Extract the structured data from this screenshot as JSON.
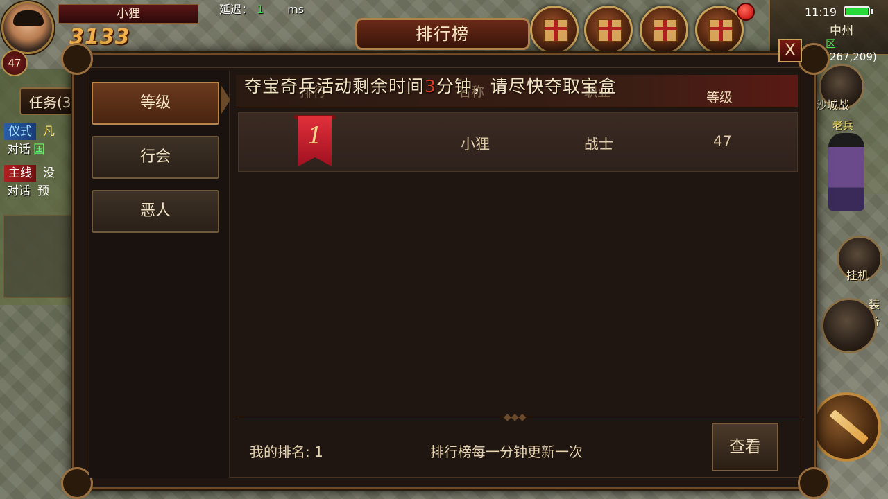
{
  "hud": {
    "player_name": "小狸",
    "player_level": "47",
    "combat_power": "3133",
    "latency_label": "延迟：",
    "latency_value": "1",
    "latency_unit": "ms",
    "quest_tab": "任务(3",
    "quests": [
      {
        "tag": "仪式",
        "tag_color": "blue",
        "text": "凡"
      },
      {
        "tag": "对话",
        "text": "国"
      },
      {
        "tag": "主线",
        "tag_color": "red",
        "text": "没"
      },
      {
        "tag": "对话",
        "text": "预"
      }
    ]
  },
  "status": {
    "time": "11:19",
    "zone": "中州",
    "zone_marker": "区",
    "coordinates": "(267,209)"
  },
  "side": {
    "sabak_label": "沙城战",
    "npc_name": "老兵",
    "afk_label": "挂机",
    "equip_label": "装备"
  },
  "dialog": {
    "title": "排行榜",
    "close_label": "X",
    "tabs": [
      {
        "label": "等级",
        "active": true
      },
      {
        "label": "行会",
        "active": false
      },
      {
        "label": "恶人",
        "active": false
      }
    ],
    "notice_prefix": "夺宝奇兵活动剩余时间",
    "notice_minutes": "3",
    "notice_suffix": "分钟，请尽快夺取宝盒",
    "columns": [
      "排行",
      "名称",
      "职业",
      "等级"
    ],
    "rows": [
      {
        "rank": "1",
        "name": "小狸",
        "class": "战士",
        "level": "47"
      }
    ],
    "my_rank_label": "我的排名: 1",
    "update_note": "排行榜每一分钟更新一次",
    "view_button": "查看"
  },
  "colors": {
    "accent_red": "#e23a1e",
    "panel_bg": "#1f1612",
    "gold_border": "#b0804a"
  }
}
